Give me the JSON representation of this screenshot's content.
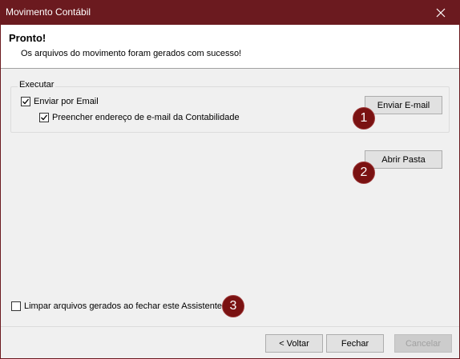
{
  "window": {
    "title": "Movimento Contábil"
  },
  "header": {
    "title": "Pronto!",
    "subtitle": "Os arquivos do movimento foram gerados com sucesso!"
  },
  "group": {
    "legend": "Executar",
    "send_email": {
      "label": "Enviar por Email",
      "checked": true
    },
    "fill_address": {
      "label": "Preencher endereço de e-mail da Contabilidade",
      "checked": true
    }
  },
  "buttons": {
    "send_email": "Enviar E-mail",
    "open_folder": "Abrir Pasta",
    "back": "< Voltar",
    "close": "Fechar",
    "cancel": "Cancelar"
  },
  "clean_files": {
    "label": "Limpar arquivos gerados ao fechar este Assistente",
    "checked": false
  },
  "badges": [
    "1",
    "2",
    "3"
  ],
  "colors": {
    "titlebar": "#6b1a1f",
    "badge": "#7a1212"
  }
}
